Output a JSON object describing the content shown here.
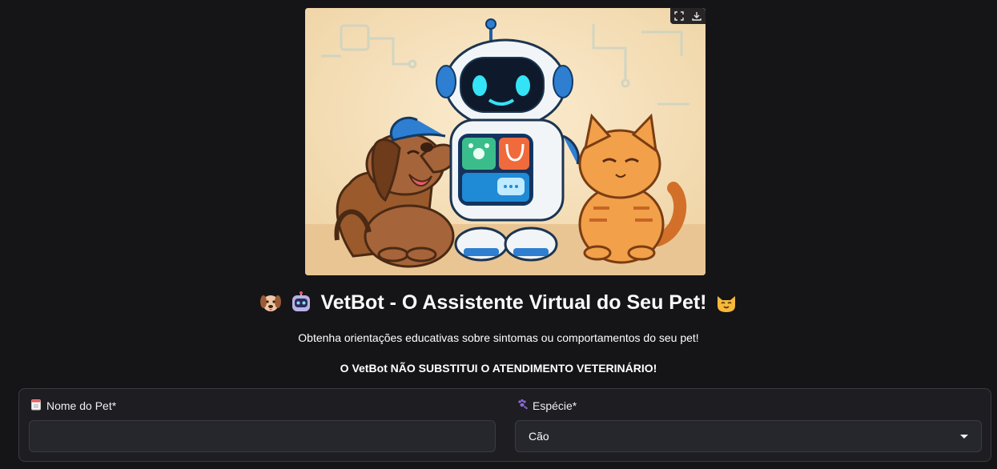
{
  "hero": {
    "toolbar": {
      "fullscreen_icon": "fullscreen-icon",
      "download_icon": "download-icon"
    }
  },
  "header": {
    "title": "VetBot - O Assistente Virtual do Seu Pet!",
    "emoji_left": [
      "dog-face-icon",
      "robot-face-icon"
    ],
    "emoji_right": "cat-face-icon"
  },
  "subtitle": "Obtenha orientações educativas sobre sintomas ou comportamentos do seu pet!",
  "warning": "O VetBot NÃO SUBSTITUI O ATENDIMENTO VETERINÁRIO!",
  "form": {
    "pet_name": {
      "label": "Nome do Pet*",
      "icon": "notepad-icon",
      "value": ""
    },
    "species": {
      "label": "Espécie*",
      "icon": "paw-prints-icon",
      "selected": "Cão"
    }
  },
  "colors": {
    "background": "#151518",
    "form_bg": "#1d1d22",
    "input_bg": "#26272d",
    "border": "#3b3c43",
    "text": "#fafafa"
  }
}
